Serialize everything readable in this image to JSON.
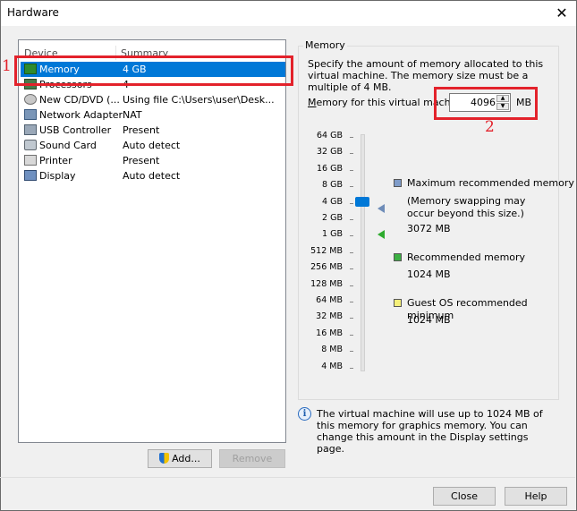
{
  "window": {
    "title": "Hardware",
    "close_glyph": "✕"
  },
  "device_list": {
    "headers": {
      "device": "Device",
      "summary": "Summary"
    },
    "rows": [
      {
        "device": "Memory",
        "summary": "4 GB",
        "icon": "memory-icon",
        "selected": true
      },
      {
        "device": "Processors",
        "summary": "4",
        "icon": "processor-icon"
      },
      {
        "device": "New CD/DVD (...",
        "summary": "Using file C:\\Users\\user\\Desk...",
        "icon": "cd-dvd-icon"
      },
      {
        "device": "Network Adapter",
        "summary": "NAT",
        "icon": "network-adapter-icon"
      },
      {
        "device": "USB Controller",
        "summary": "Present",
        "icon": "usb-icon"
      },
      {
        "device": "Sound Card",
        "summary": "Auto detect",
        "icon": "sound-card-icon"
      },
      {
        "device": "Printer",
        "summary": "Present",
        "icon": "printer-icon"
      },
      {
        "device": "Display",
        "summary": "Auto detect",
        "icon": "display-icon"
      }
    ]
  },
  "buttons": {
    "add": "Add...",
    "remove": "Remove",
    "close": "Close",
    "help": "Help"
  },
  "memory_panel": {
    "group_label": "Memory",
    "description": "Specify the amount of memory allocated to this virtual machine. The memory size must be a multiple of 4 MB.",
    "field_label_prefix": "M",
    "field_label_rest": "emory for this virtual machine",
    "value": "4096",
    "unit": "MB",
    "slider_labels": [
      "64 GB",
      "32 GB",
      "16 GB",
      "8 GB",
      "4 GB",
      "2 GB",
      "1 GB",
      "512 MB",
      "256 MB",
      "128 MB",
      "64 MB",
      "32 MB",
      "16 MB",
      "8 MB",
      "4 MB"
    ],
    "slider_selected": "4 GB",
    "legend": {
      "max_title": "Maximum recommended memory",
      "max_note": "(Memory swapping may occur beyond this size.)",
      "max_value": "3072 MB",
      "rec_title": "Recommended memory",
      "rec_value": "1024 MB",
      "guest_title": "Guest OS recommended minimum",
      "guest_value": "1024 MB"
    },
    "info": "The virtual machine will use up to 1024 MB of this memory for graphics memory. You can change this amount in the Display settings page."
  },
  "annotations": {
    "one": "1",
    "two": "2"
  },
  "colors": {
    "selection": "#0078d7",
    "annotation": "#e3222b",
    "max_swatch": "#7f9cc9",
    "rec_swatch": "#3cb043",
    "guest_swatch": "#f5f07a"
  }
}
